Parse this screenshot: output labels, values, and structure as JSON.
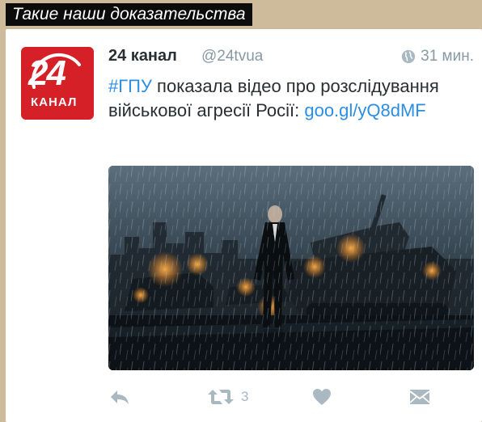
{
  "banner": {
    "text": "Такие наши доказательства"
  },
  "tweet": {
    "display_name": "24 канал",
    "handle": "@24tvua",
    "time": "31 мин.",
    "text": {
      "hashtag": "#ГПУ",
      "body": " показала відео про розслідування військової агресії Росії: ",
      "link": "goo.gl/yQ8dMF"
    },
    "avatar": {
      "logo_number": "24",
      "logo_word": "КАНАЛ",
      "brand_color": "#d62027"
    },
    "actions": {
      "retweet_count": "3"
    }
  },
  "colors": {
    "link": "#2b8ee3",
    "muted": "#8899a6",
    "icon": "#aab8c2",
    "text": "#292f33",
    "background": "#cdbb9b"
  },
  "icons": [
    "globe-icon",
    "reply-icon",
    "retweet-icon",
    "like-icon",
    "direct-message-icon"
  ]
}
